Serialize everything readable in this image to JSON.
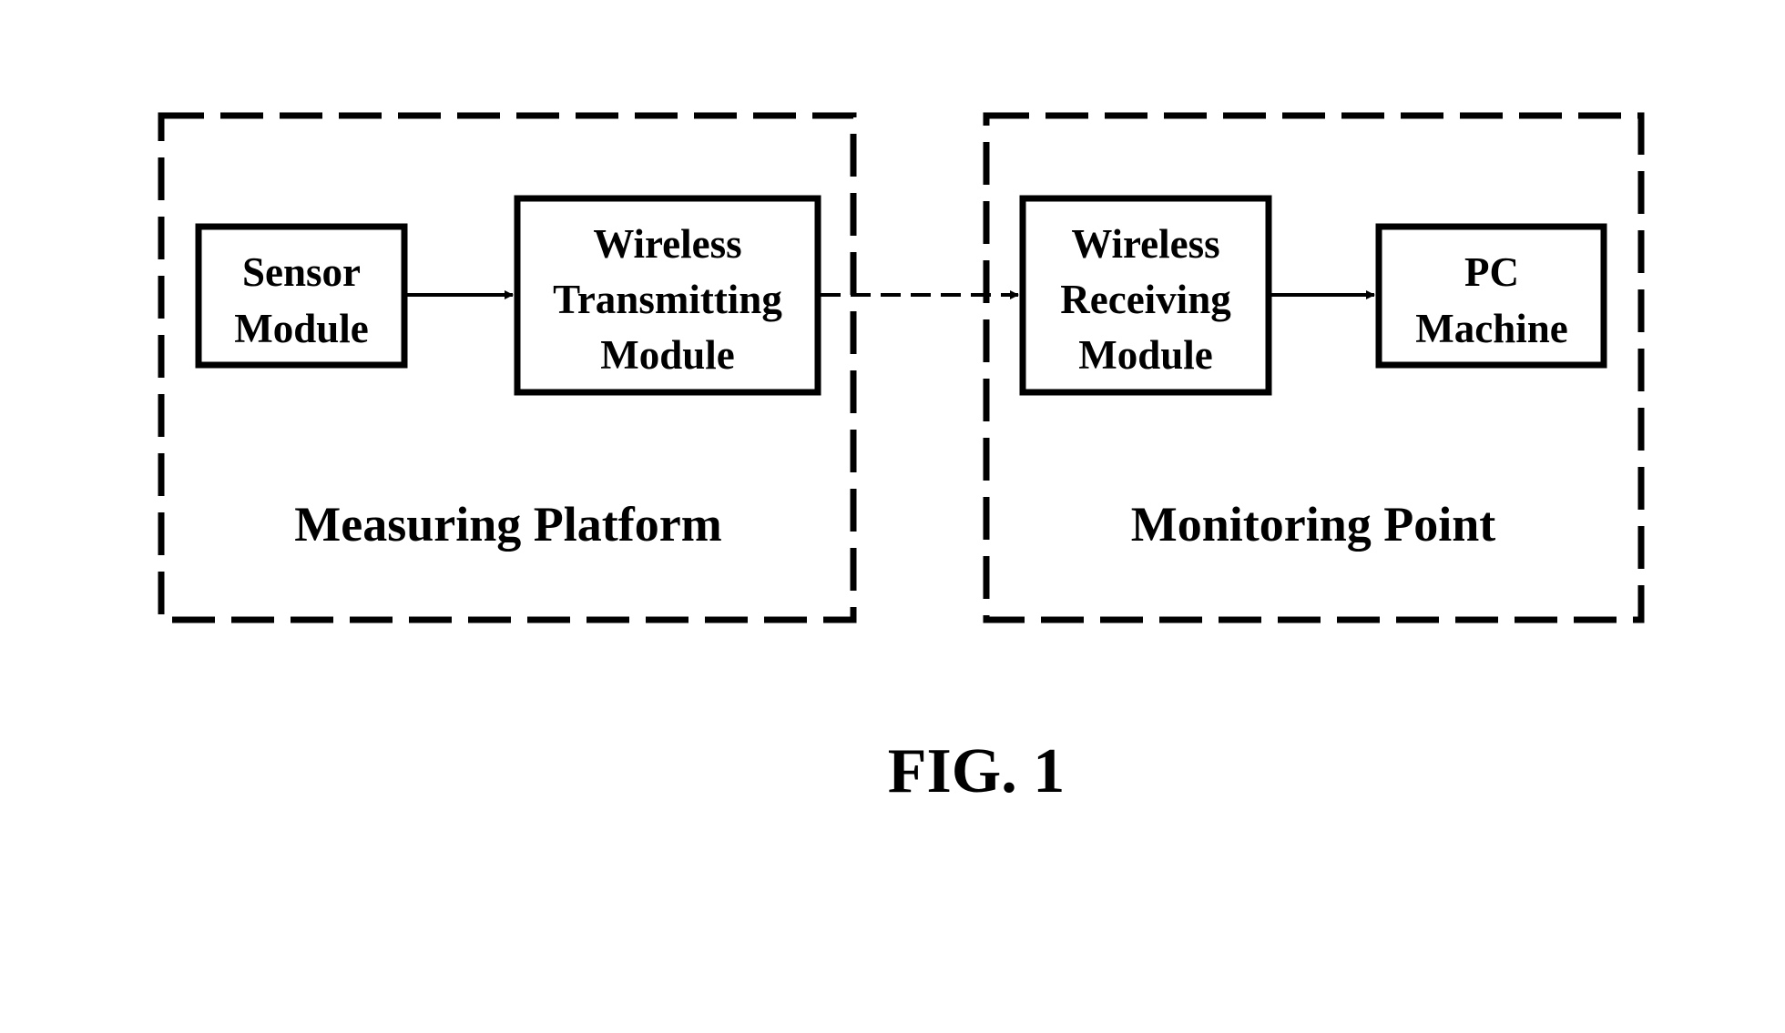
{
  "figure": {
    "caption": "FIG. 1",
    "colors": {
      "ink": "#000000",
      "background": "#ffffff"
    }
  },
  "groups": [
    {
      "id": "measuring-platform",
      "label": "Measuring Platform"
    },
    {
      "id": "monitoring-point",
      "label": "Monitoring Point"
    }
  ],
  "modules": [
    {
      "id": "sensor-module",
      "group": "measuring-platform",
      "lines": [
        "Sensor",
        "Module"
      ]
    },
    {
      "id": "wireless-transmitting-module",
      "group": "measuring-platform",
      "lines": [
        "Wireless",
        "Transmitting",
        "Module"
      ]
    },
    {
      "id": "wireless-receiving-module",
      "group": "monitoring-point",
      "lines": [
        "Wireless",
        "Receiving",
        "Module"
      ]
    },
    {
      "id": "pc-machine",
      "group": "monitoring-point",
      "lines": [
        "PC",
        "Machine"
      ]
    }
  ],
  "connections": [
    {
      "from": "sensor-module",
      "to": "wireless-transmitting-module",
      "style": "solid"
    },
    {
      "from": "wireless-transmitting-module",
      "to": "wireless-receiving-module",
      "style": "dashed"
    },
    {
      "from": "wireless-receiving-module",
      "to": "pc-machine",
      "style": "solid"
    }
  ]
}
